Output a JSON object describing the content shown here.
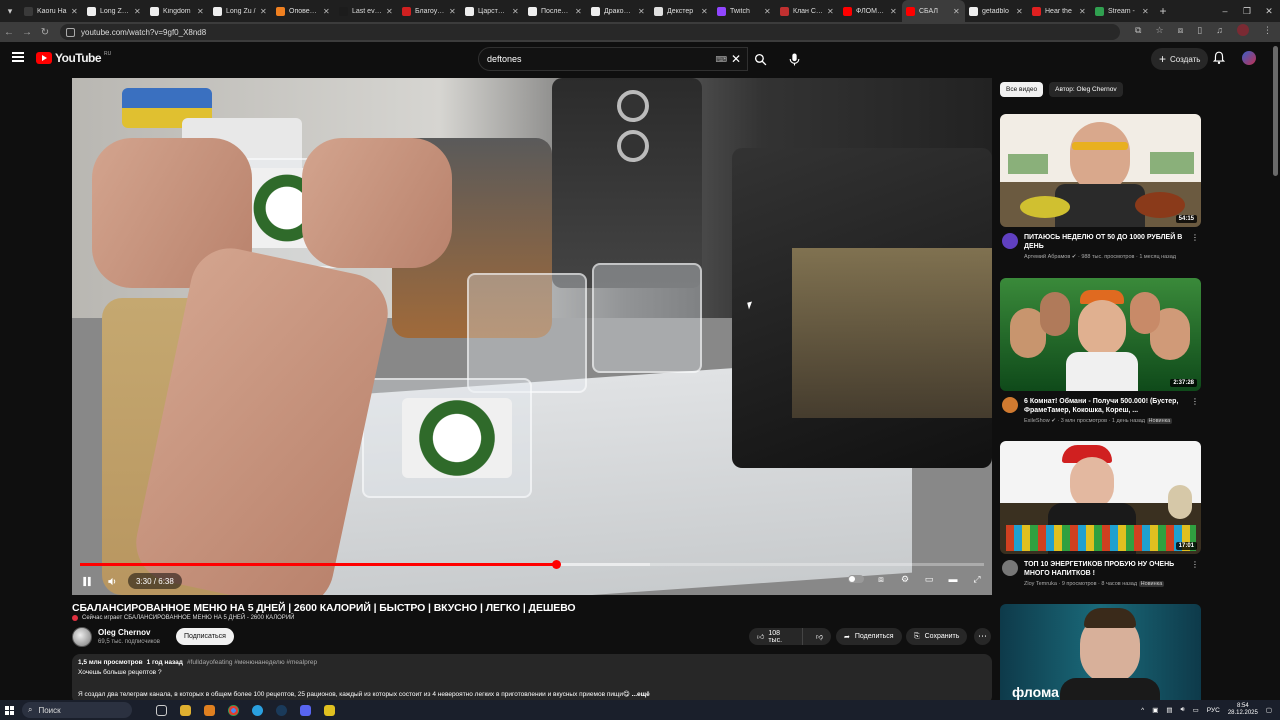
{
  "browser": {
    "tabs": [
      {
        "label": "Kaoru Ha",
        "color": "#3a3a3a"
      },
      {
        "label": "Long Zu II",
        "color": "#eeeeee"
      },
      {
        "label": "Kingdom",
        "color": "#eeeeee"
      },
      {
        "label": "Long Zu /",
        "color": "#eeeeee"
      },
      {
        "label": "Оповещен",
        "color": "#f08020"
      },
      {
        "label": "Last even",
        "color": "#1c1c1c"
      },
      {
        "label": "Благоухан",
        "color": "#d02020"
      },
      {
        "label": "Царство с",
        "color": "#eeeeee"
      },
      {
        "label": "Последни",
        "color": "#eeeeee"
      },
      {
        "label": "Дракон Р",
        "color": "#eeeeee"
      },
      {
        "label": "Декстер",
        "color": "#e0e0e0"
      },
      {
        "label": "Twitch",
        "color": "#9146ff"
      },
      {
        "label": "Клан Сопр",
        "color": "#c03030"
      },
      {
        "label": "ФЛОМАС",
        "color": "#ff0000"
      },
      {
        "label": "СБАЛ",
        "color": "#ff0000"
      },
      {
        "label": "getadblo",
        "color": "#eeeeee"
      },
      {
        "label": "Hear the",
        "color": "#e02020"
      },
      {
        "label": "Stream -",
        "color": "#30a050"
      }
    ],
    "active_tab_index": 14,
    "url": "youtube.com/watch?v=9gf0_X8nd8"
  },
  "header": {
    "logo_text": "YouTube",
    "logo_region": "RU",
    "search_value": "deftones",
    "create_label": "Создать"
  },
  "player": {
    "time_current": "3:30",
    "time_total": "6:38",
    "time_display": "3:30 / 6:38",
    "progress_fraction": 0.527,
    "buffer_fraction": 0.63
  },
  "video": {
    "title": "СБАЛАНСИРОВАННОЕ МЕНЮ НА 5 ДНЕЙ | 2600 КАЛОРИЙ | БЫСТРО | ВКУСНО | ЛЕГКО | ДЕШЕВО",
    "now_playing": "Сейчас играет СБАЛАНСИРОВАННОЕ МЕНЮ НА 5 ДНЕЙ - 2600 КАЛОРИЙ",
    "channel_name": "Oleg Chernov",
    "channel_subs": "69,5 тыс. подписчиков",
    "subscribe_label": "Подписаться",
    "likes": "108 тыс.",
    "share_label": "Поделиться",
    "save_label": "Сохранить"
  },
  "description": {
    "views": "1,5 млн просмотров",
    "age": "1 год назад",
    "tags": "#fulldayofeating #менюнанеделю #mealprep",
    "line1": "Хочешь больше рецептов ?",
    "line2": "Я создал два телеграм канала, в которых в общем более 100 рецептов, 25 рационов, каждый из которых состоит из 4 невероятно легких в приготовлении и вкусных приемов пищи😋",
    "more": "...ещё"
  },
  "sidebar": {
    "chips": [
      "Все видео",
      "Автор: Oleg Chernov"
    ],
    "recommendations": [
      {
        "title": "ПИТАЮСЬ НЕДЕЛЮ ОТ 50 ДО 1000 РУБЛЕЙ В ДЕНЬ",
        "channel": "Артемий Абрамов",
        "views": "988 тыс. просмотров",
        "age": "1 месяц назад",
        "duration": "54:15",
        "badge": ""
      },
      {
        "title": "6 Комнат! Обмани - Получи 500.000! (Бустер, ФрамеТамер, Кокошка, Кореш, ...",
        "channel": "ExileShow",
        "views": "3 млн просмотров",
        "age": "1 день назад",
        "duration": "2:37:28",
        "badge": "Новинка"
      },
      {
        "title": "ТОП 10 ЭНЕРГЕТИКОВ ПРОБУЮ НУ ОЧЕНЬ МНОГО НАПИТКОВ !",
        "channel": "Zloy Temruka",
        "views": "9 просмотров",
        "age": "8 часов назад",
        "duration": "17:01",
        "badge": "Новинка"
      },
      {
        "title": "",
        "channel": "",
        "views": "",
        "age": "",
        "duration": "",
        "badge": "",
        "overlay_text": "флома"
      }
    ]
  },
  "taskbar": {
    "search_label": "Поиск",
    "lang": "РУС",
    "time": "8:54",
    "date": "28.12.2025"
  }
}
